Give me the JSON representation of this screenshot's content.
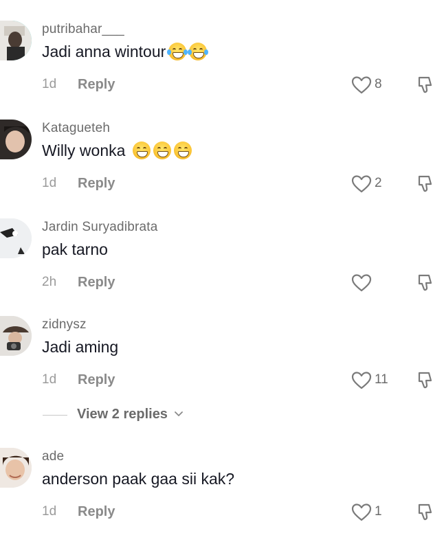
{
  "comments": [
    {
      "username": "putribahar___",
      "text": "Jadi anna wintour",
      "emojis": [
        "face-with-tears-of-joy",
        "face-with-tears-of-joy"
      ],
      "time": "1d",
      "reply_label": "Reply",
      "likes": "8",
      "avatar_ring_color": "#25d9d0"
    },
    {
      "username": "Katagueteh",
      "text": "Willy wonka",
      "emojis": [
        "grinning-face",
        "grinning-face",
        "grinning-face"
      ],
      "time": "1d",
      "reply_label": "Reply",
      "likes": "2"
    },
    {
      "username": "Jardin Suryadibrata",
      "text": "pak tarno",
      "emojis": [],
      "time": "2h",
      "reply_label": "Reply",
      "likes": ""
    },
    {
      "username": "zidnysz",
      "text": "Jadi aming",
      "emojis": [],
      "time": "1d",
      "reply_label": "Reply",
      "likes": "11"
    },
    {
      "username": "ade",
      "text": "anderson paak gaa sii kak?",
      "emojis": [],
      "time": "1d",
      "reply_label": "Reply",
      "likes": "1"
    }
  ],
  "view_replies": {
    "label": "View 2 replies"
  },
  "colors": {
    "text": "#161823",
    "muted": "#8a8a8a",
    "ring": "#25d9d0"
  },
  "icons": {
    "like": "heart-outline-icon",
    "dislike": "thumbs-down-outline-icon",
    "expand": "chevron-down-icon"
  }
}
